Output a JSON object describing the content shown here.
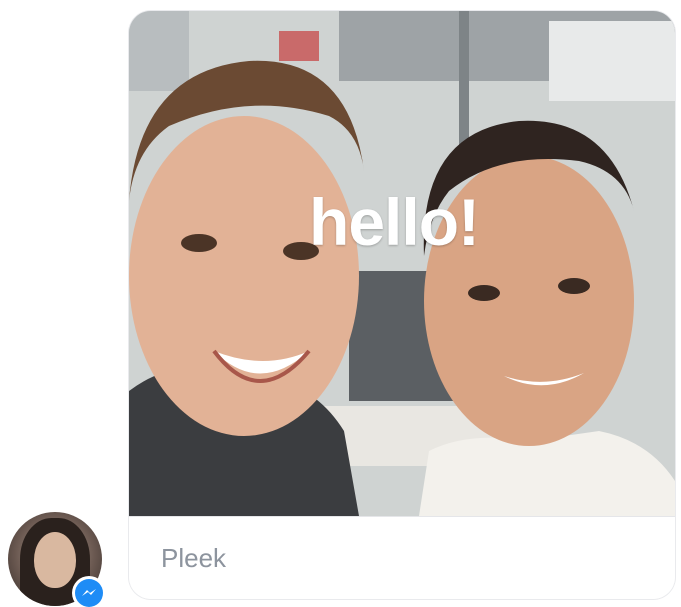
{
  "message": {
    "overlay_text": "hello!",
    "caption": "Pleek"
  },
  "sender": {
    "avatar_icon": "avatar",
    "badge_icon": "messenger-icon",
    "badge_color": "#1e8cf6"
  },
  "colors": {
    "caption_text": "#8d949e",
    "overlay_text": "#ffffff"
  }
}
